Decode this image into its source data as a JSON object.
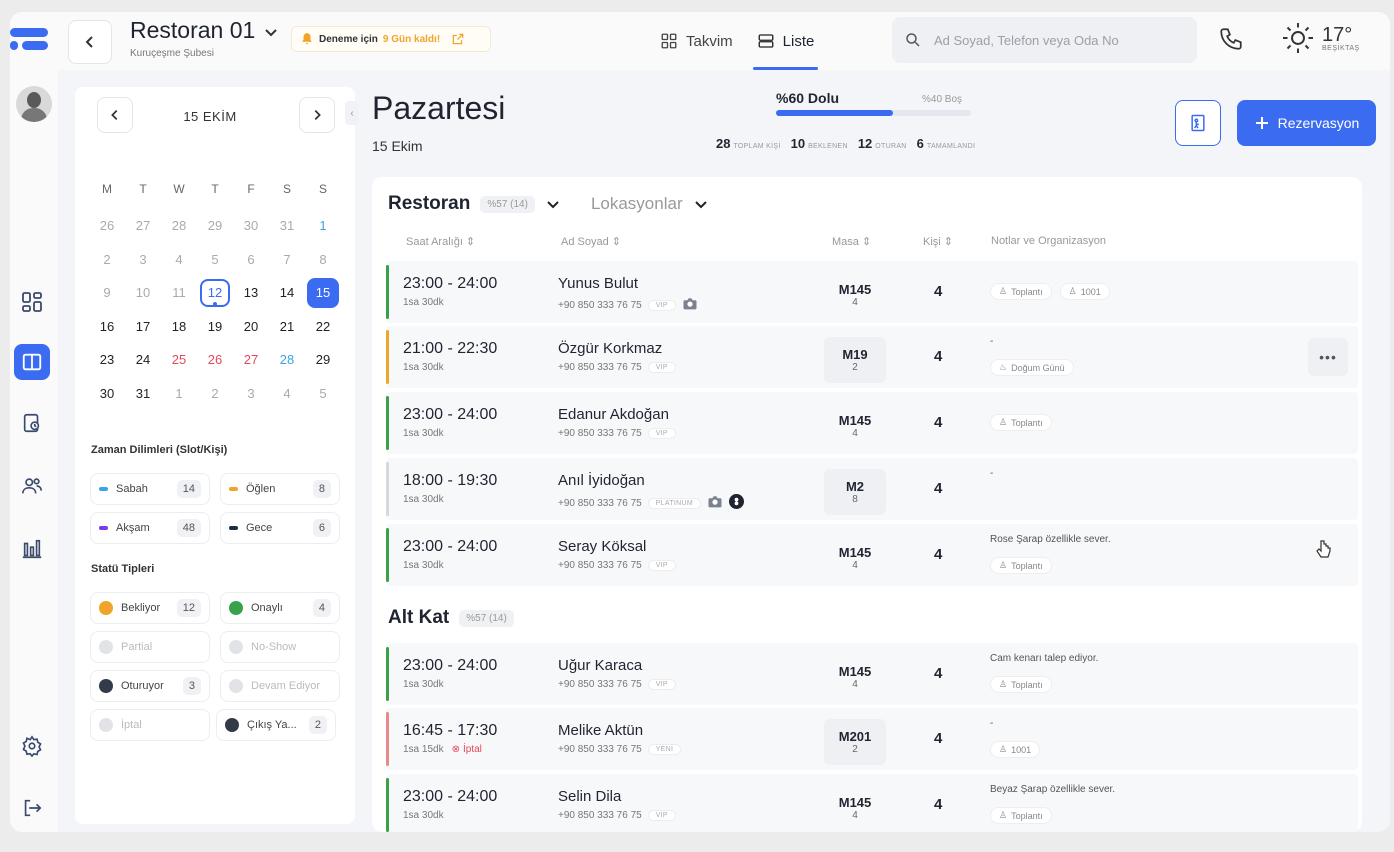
{
  "header": {
    "title": "Restoran 01",
    "subtitle": "Kuruçeşme Şubesi",
    "trial_prefix": "Deneme için",
    "trial_days": "9 Gün kaldı!",
    "tabs": [
      {
        "label": "Takvim"
      },
      {
        "label": "Liste"
      }
    ],
    "search_placeholder": "Ad Soyad, Telefon veya Oda No",
    "weather_temp": "17°",
    "weather_location": "BEŞİKTAŞ"
  },
  "calendar": {
    "month": "15 EKİM",
    "weekdays": [
      "M",
      "T",
      "W",
      "T",
      "F",
      "S",
      "S"
    ],
    "days": [
      [
        "26",
        "muted"
      ],
      [
        "27",
        "muted"
      ],
      [
        "28",
        "muted"
      ],
      [
        "29",
        "muted"
      ],
      [
        "30",
        "muted"
      ],
      [
        "31",
        "muted"
      ],
      [
        "1",
        "muted blue"
      ],
      [
        "2",
        "muted"
      ],
      [
        "3",
        "muted"
      ],
      [
        "4",
        "muted"
      ],
      [
        "5",
        "muted"
      ],
      [
        "6",
        "muted"
      ],
      [
        "7",
        "muted"
      ],
      [
        "8",
        "muted"
      ],
      [
        "9",
        "muted"
      ],
      [
        "10",
        "muted"
      ],
      [
        "11",
        "muted"
      ],
      [
        "12",
        "today"
      ],
      [
        "13",
        ""
      ],
      [
        "14",
        ""
      ],
      [
        "15",
        "sel"
      ],
      [
        "16",
        ""
      ],
      [
        "17",
        ""
      ],
      [
        "18",
        ""
      ],
      [
        "19",
        ""
      ],
      [
        "20",
        ""
      ],
      [
        "21",
        ""
      ],
      [
        "22",
        ""
      ],
      [
        "23",
        ""
      ],
      [
        "24",
        ""
      ],
      [
        "25",
        "red"
      ],
      [
        "26",
        "red"
      ],
      [
        "27",
        "red"
      ],
      [
        "28",
        "blue"
      ],
      [
        "29",
        ""
      ],
      [
        "30",
        ""
      ],
      [
        "31",
        ""
      ],
      [
        "1",
        "muted"
      ],
      [
        "2",
        "muted"
      ],
      [
        "3",
        "muted"
      ],
      [
        "4",
        "muted"
      ],
      [
        "5",
        "muted"
      ]
    ],
    "slots_title": "Zaman Dilimleri (Slot/Kişi)",
    "slots": [
      {
        "label": "Sabah",
        "count": "14",
        "color": "#3aa4e8"
      },
      {
        "label": "Öğlen",
        "count": "8",
        "color": "#f0a52a"
      },
      {
        "label": "Akşam",
        "count": "48",
        "color": "#7b3be8"
      },
      {
        "label": "Gece",
        "count": "6",
        "color": "#1f2a44"
      }
    ],
    "status_title": "Statü Tipleri",
    "statuses": [
      {
        "label": "Bekliyor",
        "count": "12",
        "color": "#f0a52a"
      },
      {
        "label": "Onaylı",
        "count": "4",
        "color": "#3aa04a"
      },
      {
        "label": "Partial",
        "count": "",
        "color": ""
      },
      {
        "label": "No-Show",
        "count": "",
        "color": ""
      },
      {
        "label": "Oturuyor",
        "count": "3",
        "color": "#333a48"
      },
      {
        "label": "Devam Ediyor",
        "count": "",
        "color": ""
      },
      {
        "label": "İptal",
        "count": "",
        "color": ""
      },
      {
        "label": "Çıkış Ya...",
        "count": "2",
        "color": "#333a48"
      }
    ]
  },
  "summary": {
    "day": "Pazartesi",
    "date": "15 Ekim",
    "full_label": "%60 Dolu",
    "empty_label": "%40 Boş",
    "full_fraction": 0.6,
    "stats": [
      {
        "value": "28",
        "label": "TOPLAM KİŞİ"
      },
      {
        "value": "10",
        "label": "BEKLENEN"
      },
      {
        "value": "12",
        "label": "OTURAN"
      },
      {
        "value": "6",
        "label": "TAMAMLANDI"
      }
    ],
    "reservation_button": "Rezervasyon"
  },
  "list": {
    "group1": "Restoran",
    "group1_badge": "%57 (14)",
    "locations": "Lokasyonlar",
    "columns": [
      "Saat Aralığı",
      "Ad Soyad",
      "Masa",
      "Kişi",
      "Notlar ve Organizasyon"
    ],
    "group2": "Alt Kat",
    "group2_badge": "%57 (14)",
    "rows1": [
      {
        "time": "23:00 - 24:00",
        "dur": "1sa 30dk",
        "name": "Yunus Bulut",
        "phone": "+90 850 333 76 75",
        "tag": "VIP",
        "table": "M145",
        "seats": "4",
        "count": "4",
        "note": "",
        "pills": [
          "Toplantı",
          "1001"
        ],
        "color": "#3aa04a"
      },
      {
        "time": "21:00 - 22:30",
        "dur": "1sa 30dk",
        "name": "Özgür Korkmaz",
        "phone": "+90 850 333 76 75",
        "tag": "VIP",
        "table": "M19",
        "seats": "2",
        "count": "4",
        "note": "-",
        "pills": [
          "Doğum Günü"
        ],
        "color": "#f0a52a"
      },
      {
        "time": "23:00 - 24:00",
        "dur": "1sa 30dk",
        "name": "Edanur Akdoğan",
        "phone": "+90 850 333 76 75",
        "tag": "VIP",
        "table": "M145",
        "seats": "4",
        "count": "4",
        "note": "",
        "pills": [
          "Toplantı"
        ],
        "color": "#3aa04a"
      },
      {
        "time": "18:00 - 19:30",
        "dur": "1sa 30dk",
        "name": "Anıl İyidoğan",
        "phone": "+90 850 333 76 75",
        "tag": "PLATINUM",
        "table": "M2",
        "seats": "8",
        "count": "4",
        "note": "-",
        "pills": [],
        "color": "#d5d8de"
      },
      {
        "time": "23:00 - 24:00",
        "dur": "1sa 30dk",
        "name": "Seray Köksal",
        "phone": "+90 850 333 76 75",
        "tag": "VIP",
        "table": "M145",
        "seats": "4",
        "count": "4",
        "note": "Rose Şarap özellikle sever.",
        "pills": [
          "Toplantı"
        ],
        "color": "#3aa04a"
      }
    ],
    "rows2": [
      {
        "time": "23:00 - 24:00",
        "dur": "1sa 30dk",
        "name": "Uğur Karaca",
        "phone": "+90 850 333 76 75",
        "tag": "VIP",
        "table": "M145",
        "seats": "4",
        "count": "4",
        "note": "Cam kenarı talep ediyor.",
        "pills": [
          "Toplantı"
        ],
        "color": "#3aa04a"
      },
      {
        "time": "16:45 - 17:30",
        "dur": "1sa 15dk",
        "cancel": "İptal",
        "name": "Melike Aktün",
        "phone": "+90 850  333 76 75",
        "tag": "YENİ",
        "table": "M201",
        "seats": "2",
        "count": "4",
        "note": "-",
        "pills": [
          "1001"
        ],
        "color": "#e88a8a"
      },
      {
        "time": "23:00 - 24:00",
        "dur": "1sa 30dk",
        "name": "Selin Dila",
        "phone": "+90 850 333 76 75",
        "tag": "VIP",
        "table": "M145",
        "seats": "4",
        "count": "4",
        "note": "Beyaz Şarap özellikle sever.",
        "pills": [
          "Toplantı"
        ],
        "color": "#3aa04a"
      }
    ]
  }
}
